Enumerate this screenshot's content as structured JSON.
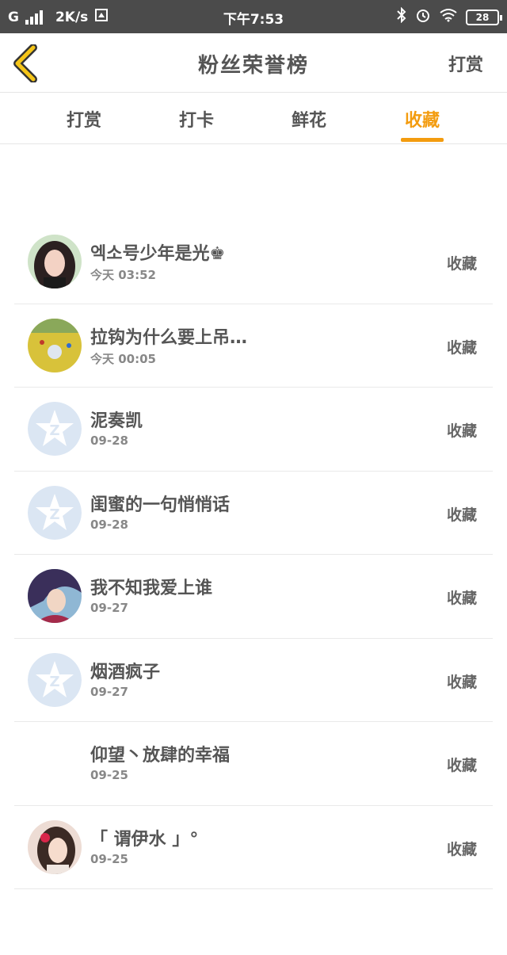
{
  "status_bar": {
    "carrier": "G",
    "net_speed": "2K/s",
    "time": "下午7:53",
    "battery": "28"
  },
  "nav": {
    "title": "粉丝荣誉榜",
    "action": "打赏"
  },
  "tabs": [
    {
      "label": "打赏",
      "active": false
    },
    {
      "label": "打卡",
      "active": false
    },
    {
      "label": "鲜花",
      "active": false
    },
    {
      "label": "收藏",
      "active": true
    }
  ],
  "colors": {
    "accent": "#f39c0f",
    "statusbar": "#4b4b4b",
    "default_avatar": "#dbe6f3"
  },
  "list": [
    {
      "name": "엑소号少年是光♚",
      "time": "今天 03:52",
      "action": "收藏",
      "avatar": "girl-photo"
    },
    {
      "name": "拉钩为什么要上吊…",
      "time": "今天 00:05",
      "action": "收藏",
      "avatar": "game-scene"
    },
    {
      "name": "泥奏凯",
      "time": "09-28",
      "action": "收藏",
      "avatar": "default-star"
    },
    {
      "name": "闺蜜的一句悄悄话",
      "time": "09-28",
      "action": "收藏",
      "avatar": "default-star"
    },
    {
      "name": "我不知我爱上谁",
      "time": "09-27",
      "action": "收藏",
      "avatar": "anime-character"
    },
    {
      "name": "烟酒疯子",
      "time": "09-27",
      "action": "收藏",
      "avatar": "default-star"
    },
    {
      "name": "仰望丶放肆的幸福",
      "time": "09-25",
      "action": "收藏",
      "avatar": "none"
    },
    {
      "name": "「 谓伊水 」°",
      "time": "09-25",
      "action": "收藏",
      "avatar": "girl-flower"
    }
  ]
}
